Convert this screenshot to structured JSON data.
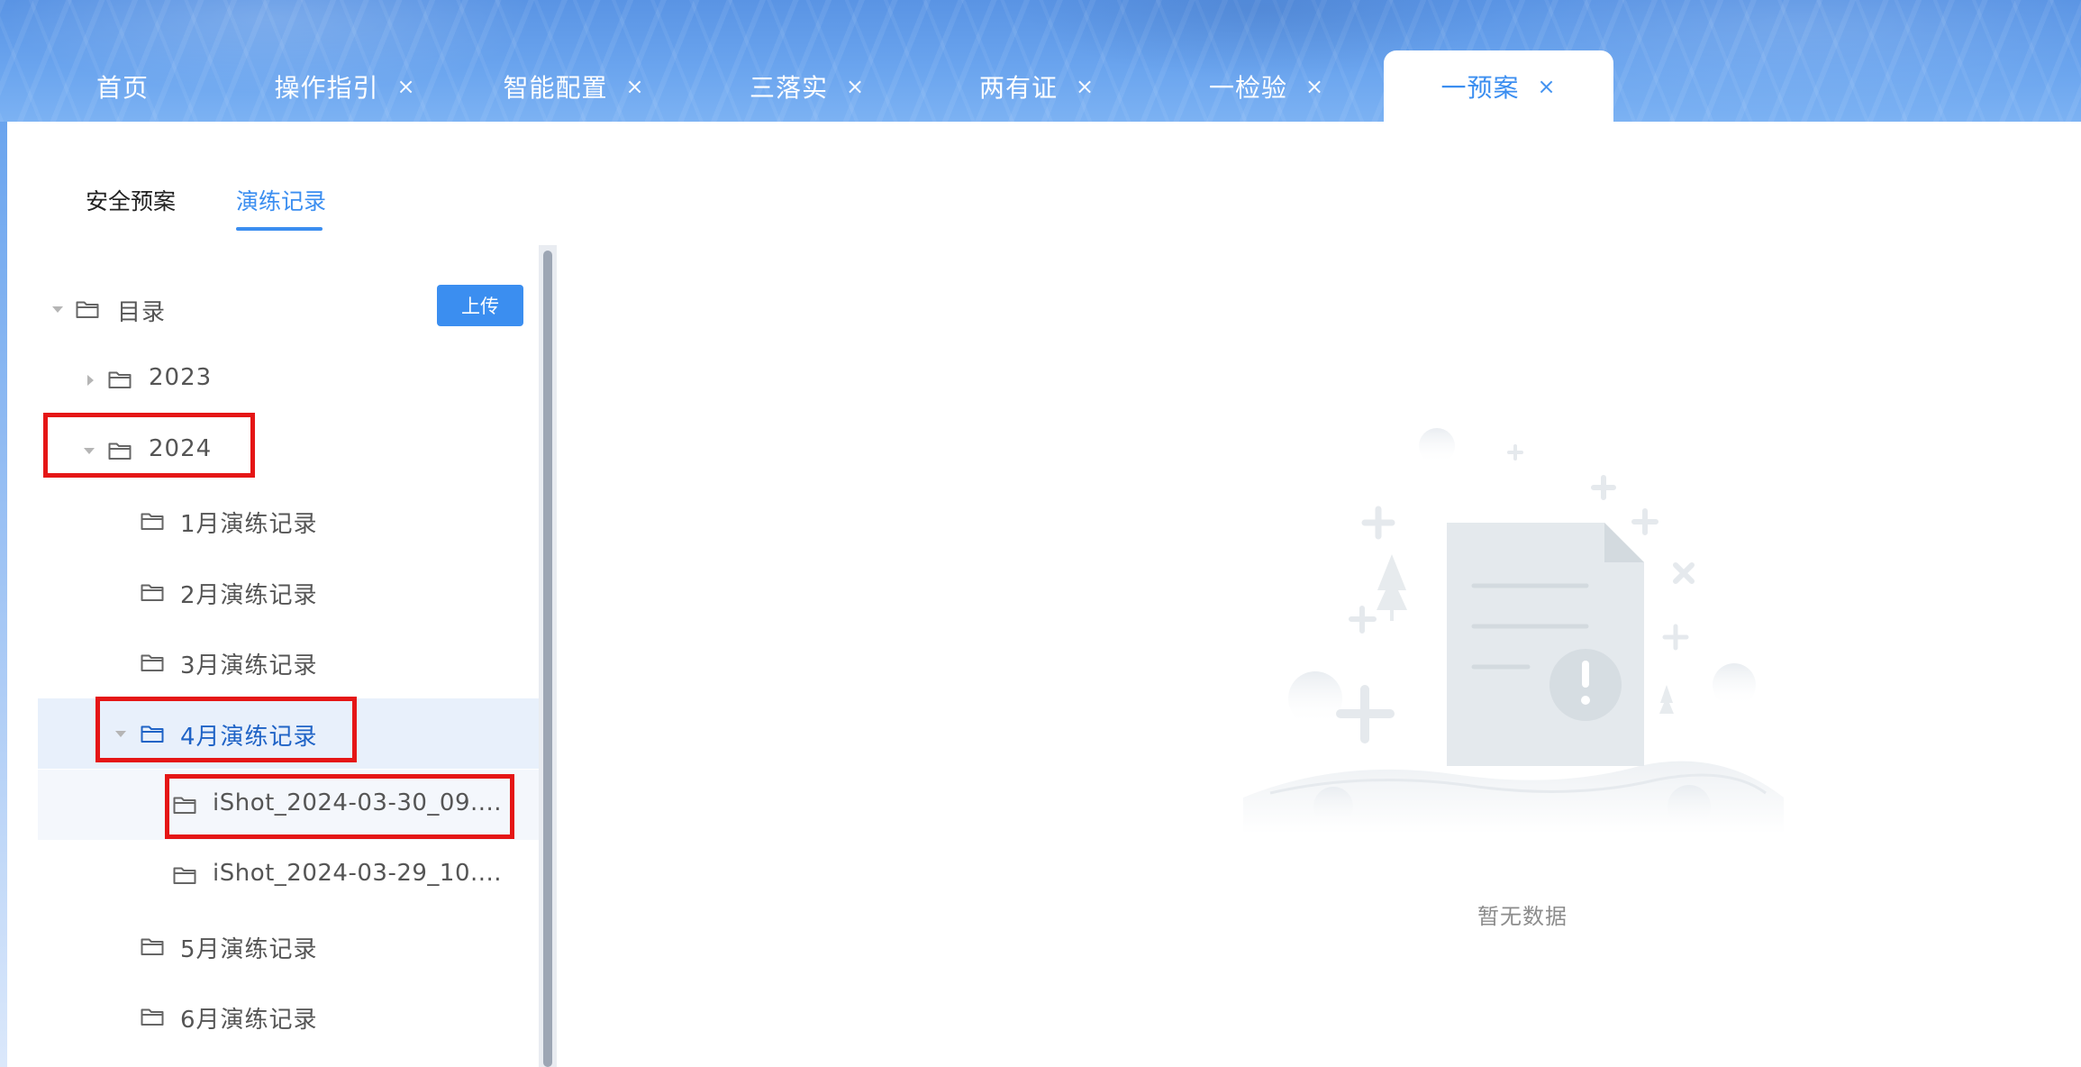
{
  "tabs": [
    {
      "label": "首页",
      "closable": false,
      "active": false
    },
    {
      "label": "操作指引",
      "closable": true,
      "active": false
    },
    {
      "label": "智能配置",
      "closable": true,
      "active": false
    },
    {
      "label": "三落实",
      "closable": true,
      "active": false
    },
    {
      "label": "两有证",
      "closable": true,
      "active": false
    },
    {
      "label": "一检验",
      "closable": true,
      "active": false
    },
    {
      "label": "一预案",
      "closable": true,
      "active": true
    }
  ],
  "close_glyph": "×",
  "subtabs": [
    {
      "label": "安全预案",
      "active": false
    },
    {
      "label": "演练记录",
      "active": true
    }
  ],
  "upload_label": "上传",
  "tree": [
    {
      "label": "目录",
      "level": 0,
      "expanded": true
    },
    {
      "label": "2023",
      "level": 1,
      "expanded": false
    },
    {
      "label": "2024",
      "level": 1,
      "expanded": true
    },
    {
      "label": "1月演练记录",
      "level": 2
    },
    {
      "label": "2月演练记录",
      "level": 2
    },
    {
      "label": "3月演练记录",
      "level": 2
    },
    {
      "label": "4月演练记录",
      "level": 2,
      "expanded": true,
      "selected": true
    },
    {
      "label": "iShot_2024-03-30_09....",
      "level": 3
    },
    {
      "label": "iShot_2024-03-29_10....",
      "level": 3
    },
    {
      "label": "5月演练记录",
      "level": 2
    },
    {
      "label": "6月演练记录",
      "level": 2
    }
  ],
  "empty_text": "暂无数据",
  "colors": {
    "accent": "#3b8ef0",
    "selected_text": "#1f63c6",
    "selected_bg": "#e8f0fb",
    "annotation": "#e51616"
  },
  "icons": [
    "folder-icon",
    "close-icon",
    "caret-down-icon",
    "caret-right-icon",
    "empty-document-icon"
  ]
}
